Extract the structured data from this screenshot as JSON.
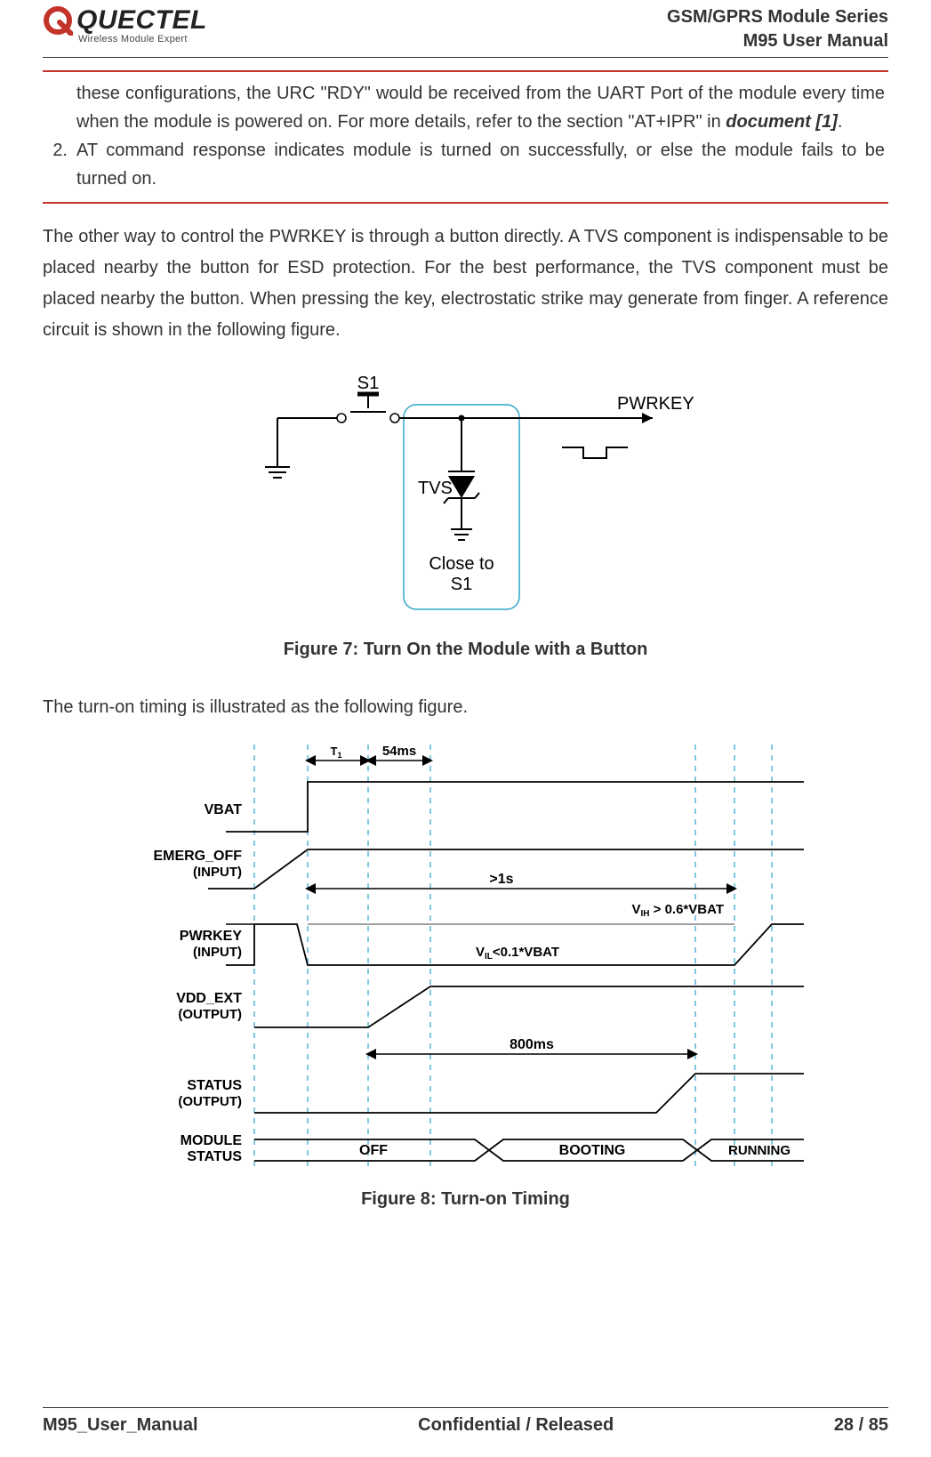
{
  "header": {
    "brand": "QUECTEL",
    "tagline": "Wireless Module Expert",
    "series": "GSM/GPRS Module Series",
    "product": "M95 User Manual"
  },
  "note": {
    "para1_a": "these configurations, the URC \"RDY\" would be received from the UART Port of the module every time when the module is powered on. For more details, refer to the section \"AT+IPR\" in ",
    "doc_ref": "document [1]",
    "para1_b": ".",
    "item2_num": "2.",
    "item2_text": "AT command response indicates module is turned on successfully, or else the module fails to be turned on."
  },
  "body": {
    "para1": "The other way to control the PWRKEY is through a button directly. A TVS component is indispensable to be placed nearby the button for ESD protection. For the best performance, the TVS component must be placed nearby the button. When pressing the key, electrostatic strike may generate from finger. A reference circuit is shown in the following figure.",
    "para2": "The turn-on timing is illustrated as the following figure."
  },
  "figure7": {
    "caption": "Figure 7: Turn On the Module with a Button",
    "labels": {
      "S1": "S1",
      "PWRKEY": "PWRKEY",
      "TVS": "TVS",
      "close": "Close to",
      "close2": "S1"
    }
  },
  "figure8": {
    "caption": "Figure 8: Turn-on Timing",
    "signals": {
      "VBAT": "VBAT",
      "EMERG_OFF": "EMERG_OFF",
      "EMERG_OFF_sub": "(INPUT)",
      "PWRKEY": "PWRKEY",
      "PWRKEY_sub": "(INPUT)",
      "VDD_EXT": "VDD_EXT",
      "VDD_EXT_sub": "(OUTPUT)",
      "STATUS": "STATUS",
      "STATUS_sub": "(OUTPUT)",
      "MODULE": "MODULE",
      "MODULE_sub": "STATUS"
    },
    "annotations": {
      "T1": "T1",
      "t54ms": "54ms",
      "gt1s": ">1s",
      "vih": "VIH > 0.6*VBAT",
      "vil": "VIL<0.1*VBAT",
      "t800": "800ms",
      "OFF": "OFF",
      "BOOTING": "BOOTING",
      "RUNNING": "RUNNING"
    }
  },
  "footer": {
    "left": "M95_User_Manual",
    "center": "Confidential / Released",
    "right": "28 / 85"
  }
}
